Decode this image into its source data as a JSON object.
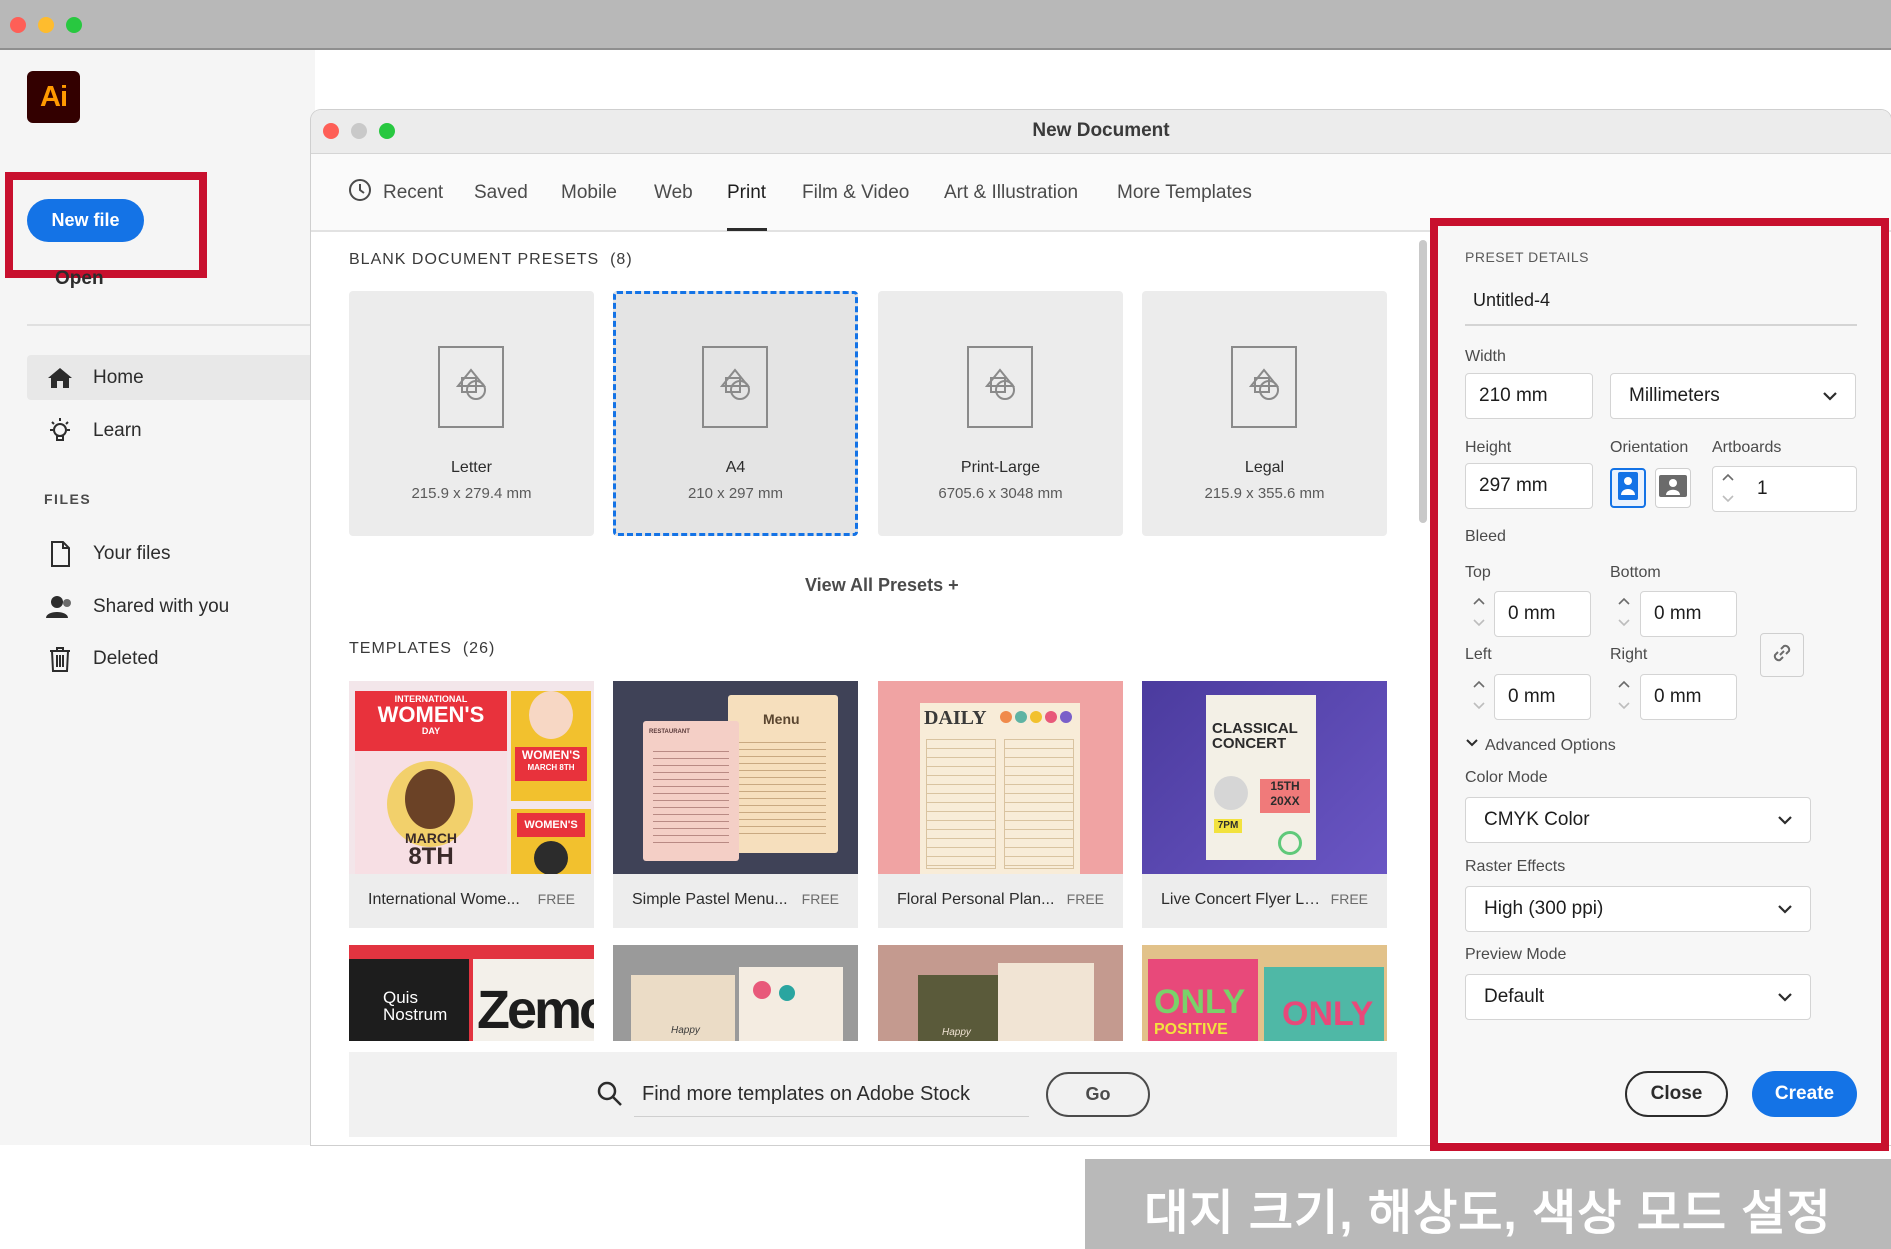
{
  "app": {
    "logo_text": "Ai",
    "new_file_label": "New file",
    "open_label": "Open",
    "nav": [
      {
        "label": "Home",
        "icon": "home-icon"
      },
      {
        "label": "Learn",
        "icon": "lightbulb-icon"
      }
    ],
    "files_heading": "FILES",
    "files": [
      {
        "label": "Your files",
        "icon": "file-icon"
      },
      {
        "label": "Shared with you",
        "icon": "shared-user-icon"
      },
      {
        "label": "Deleted",
        "icon": "trash-icon"
      }
    ]
  },
  "dialog": {
    "title": "New Document",
    "tabs": [
      "Recent",
      "Saved",
      "Mobile",
      "Web",
      "Print",
      "Film & Video",
      "Art & Illustration",
      "More Templates"
    ],
    "active_tab": "Print",
    "presets_heading": "BLANK DOCUMENT PRESETS",
    "presets_count": "(8)",
    "presets": [
      {
        "name": "Letter",
        "size": "215.9 x 279.4 mm"
      },
      {
        "name": "A4",
        "size": "210 x 297 mm",
        "selected": true
      },
      {
        "name": "Print-Large",
        "size": "6705.6 x 3048 mm"
      },
      {
        "name": "Legal",
        "size": "215.9 x 355.6 mm"
      }
    ],
    "view_all": "View All Presets +",
    "templates_heading": "TEMPLATES",
    "templates_count": "(26)",
    "templates": [
      {
        "name": "International Wome...",
        "badge": "FREE"
      },
      {
        "name": "Simple Pastel Menu...",
        "badge": "FREE"
      },
      {
        "name": "Floral Personal Plan...",
        "badge": "FREE"
      },
      {
        "name": "Live Concert Flyer La...",
        "badge": "FREE"
      }
    ],
    "thumb_text": {
      "womens_top": "INTERNATIONAL",
      "womens_title": "WOMEN'S",
      "womens_day": "DAY",
      "womens_march": "MARCH",
      "womens_8th": "8TH",
      "womens_small": "WOMEN'S",
      "womens_small_date": "MARCH 8TH",
      "menu_title": "Menu",
      "menu_left": "RESTAURANT",
      "daily_title": "DAILY",
      "concert_title1": "CLASSICAL",
      "concert_title2": "CONCERT",
      "concert_date": "15TH",
      "concert_year": "20XX",
      "concert_time": "7PM",
      "quis_1": "Quis",
      "quis_2": "Nostrum",
      "quis_big": "Zemo",
      "happy": "Happy",
      "only": "ONLY",
      "positive": "POSITIVE"
    },
    "stock_search_placeholder": "Find more templates on Adobe Stock",
    "go_label": "Go"
  },
  "preset_details": {
    "heading": "PRESET DETAILS",
    "name": "Untitled-4",
    "width_label": "Width",
    "width_value": "210 mm",
    "units": "Millimeters",
    "height_label": "Height",
    "height_value": "297 mm",
    "orientation_label": "Orientation",
    "artboards_label": "Artboards",
    "artboards_value": "1",
    "bleed_label": "Bleed",
    "top_label": "Top",
    "top_value": "0 mm",
    "bottom_label": "Bottom",
    "bottom_value": "0 mm",
    "left_label": "Left",
    "left_value": "0 mm",
    "right_label": "Right",
    "right_value": "0 mm",
    "advanced_label": "Advanced Options",
    "color_mode_label": "Color Mode",
    "color_mode_value": "CMYK Color",
    "raster_label": "Raster Effects",
    "raster_value": "High (300 ppi)",
    "preview_label": "Preview Mode",
    "preview_value": "Default",
    "close_label": "Close",
    "create_label": "Create"
  },
  "caption": "대지 크기, 해상도, 색상 모드 설정",
  "colors": {
    "accent": "#1473e6",
    "highlight": "#c8102e",
    "ai_logo_bg": "#330000",
    "ai_logo_text": "#ff9a00"
  }
}
